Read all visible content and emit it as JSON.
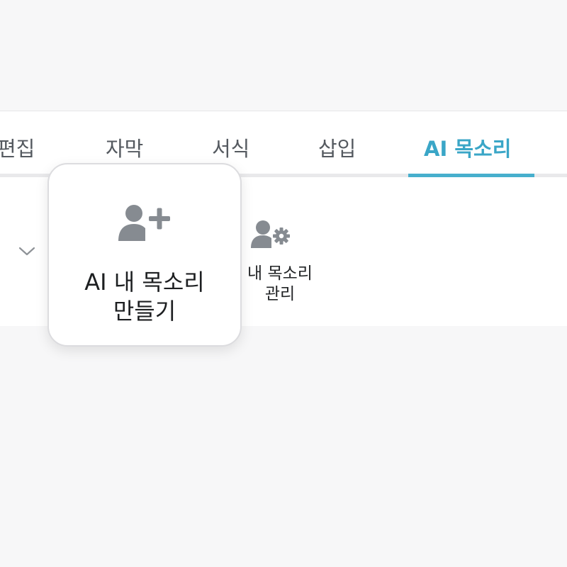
{
  "tabs": [
    {
      "label": "편집",
      "active": false
    },
    {
      "label": "자막",
      "active": false
    },
    {
      "label": "서식",
      "active": false
    },
    {
      "label": "삽입",
      "active": false
    },
    {
      "label": "AI 목소리",
      "active": true
    }
  ],
  "ribbon": {
    "expand_icon": "chevron-down-icon",
    "create_voice": {
      "label_line1": "AI 내 목소리",
      "label_line2": "만들기",
      "icon": "add-user-icon"
    },
    "manage_voice": {
      "label_line1": "내 목소리",
      "label_line2": "관리",
      "icon": "user-settings-icon"
    }
  },
  "colors": {
    "accent": "#3aa6c7",
    "icon_gray": "#868b91",
    "text": "#222426",
    "background": "#f7f7f8"
  }
}
